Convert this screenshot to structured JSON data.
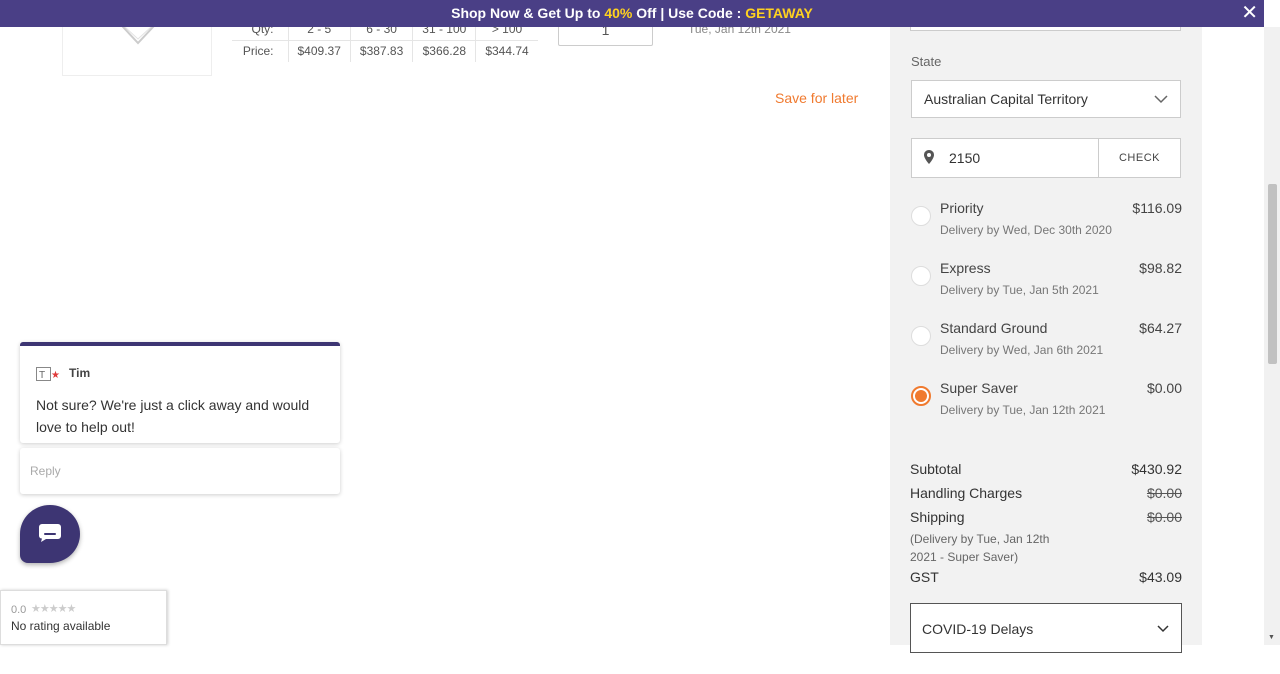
{
  "promo": {
    "text_before": "Shop Now & Get Up to ",
    "highlight_percent": "40%",
    "text_middle": " Off | Use Code : ",
    "code": "GETAWAY",
    "close_icon": "✕"
  },
  "product": {
    "qty_label": "Qty:",
    "price_label": "Price:",
    "tiers": [
      "2 - 5",
      "6 - 30",
      "31 - 100",
      "> 100"
    ],
    "prices": [
      "$409.37",
      "$387.83",
      "$366.28",
      "$344.74"
    ],
    "quantity": "1",
    "delivery": "Tue, Jan 12th 2021",
    "save_for_later": "Save for later"
  },
  "shipping": {
    "state_label": "State",
    "state_value": "Australian Capital Territory",
    "postcode": "2150",
    "check_label": "CHECK",
    "options": [
      {
        "name": "Priority",
        "price": "$116.09",
        "delivery": "Delivery by Wed, Dec 30th 2020",
        "selected": false
      },
      {
        "name": "Express",
        "price": "$98.82",
        "delivery": "Delivery by Tue, Jan 5th 2021",
        "selected": false
      },
      {
        "name": "Standard Ground",
        "price": "$64.27",
        "delivery": "Delivery by Wed, Jan 6th 2021",
        "selected": false
      },
      {
        "name": "Super Saver",
        "price": "$0.00",
        "delivery": "Delivery by Tue, Jan 12th 2021",
        "selected": true
      }
    ]
  },
  "summary": {
    "subtotal_label": "Subtotal",
    "subtotal": "$430.92",
    "handling_label": "Handling Charges",
    "handling": "$0.00",
    "shipping_label": "Shipping",
    "shipping": "$0.00",
    "shipping_note": "(Delivery by Tue, Jan 12th 2021 - Super Saver)",
    "gst_label": "GST",
    "gst": "$43.09",
    "covid_label": "COVID-19 Delays"
  },
  "chat": {
    "agent_name": "Tim",
    "message": "Not sure? We're just a click away and would love to help out!",
    "reply_placeholder": "Reply"
  },
  "rating": {
    "score": "0.0",
    "stars": "★★★★★",
    "text": "No rating available"
  },
  "colors": {
    "brand": "#4a3f86",
    "accent": "#f07a2f",
    "promo_highlight": "#ffd21f"
  }
}
